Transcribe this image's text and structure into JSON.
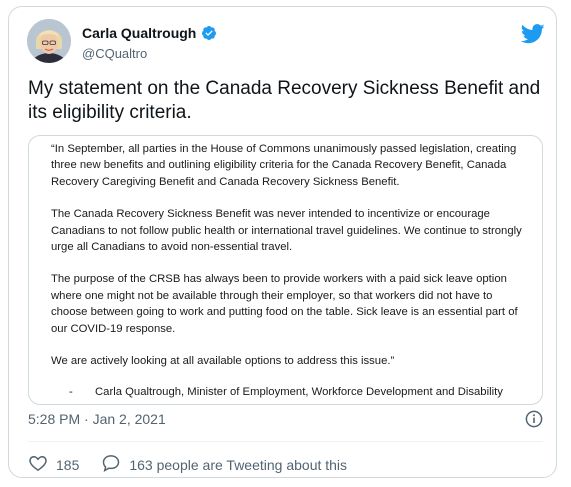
{
  "author": {
    "name": "Carla Qualtrough",
    "handle": "@CQualtro"
  },
  "tweet": {
    "text": "My statement on the Canada Recovery Sickness Benefit and its eligibility criteria."
  },
  "statement": {
    "paragraphs": [
      "“In September, all parties in the House of Commons unanimously passed legislation, creating three new benefits and outlining eligibility criteria for the Canada Recovery Benefit, Canada Recovery Caregiving Benefit and Canada Recovery Sickness Benefit.",
      "The Canada Recovery Sickness Benefit was never intended to incentivize or encourage Canadians to not follow public health or international travel guidelines. We continue to strongly urge all Canadians to avoid non-essential travel.",
      "The purpose of the CRSB has always been to provide workers with a paid sick leave option where one might not be available through their employer, so that workers did not have to choose between going to work and putting food on the table. Sick leave is an essential part of our COVID-19 response.",
      "We are actively looking at all available options to address this issue.”"
    ],
    "signature_dash": "-",
    "signature": "Carla Qualtrough, Minister of Employment, Workforce Development and Disability Inclusion"
  },
  "meta": {
    "timestamp": "5:28 PM · Jan 2, 2021"
  },
  "actions": {
    "likes": "185",
    "tweeting": "163 people are Tweeting about this"
  },
  "colors": {
    "twitter_blue": "#1d9bf0",
    "secondary_text": "#536471",
    "border": "#cfd9de"
  },
  "icons": [
    "verified-badge-icon",
    "twitter-bird-icon",
    "info-icon",
    "heart-icon",
    "speech-bubble-icon"
  ]
}
